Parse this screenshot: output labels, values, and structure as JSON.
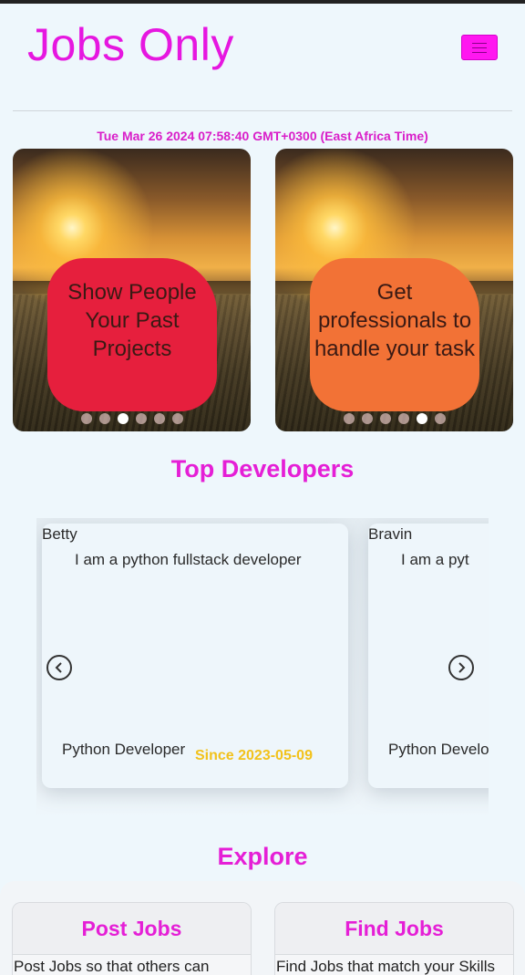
{
  "header": {
    "brand": "Jobs Only",
    "datetime": "Tue Mar 26 2024 07:58:40 GMT+0300 (East Africa Time)"
  },
  "hero_slides": [
    {
      "text": "Show People Your Past Projects",
      "color": "#e61f3d",
      "dots": 6,
      "active_dot": 3
    },
    {
      "text": "Get professionals to handle your task",
      "color": "#f27236",
      "dots": 6,
      "active_dot": 5
    }
  ],
  "top_developers": {
    "title": "Top Developers",
    "cards": [
      {
        "name": "Betty",
        "bio": "I am a python fullstack developer",
        "role": "Python Developer",
        "since": "Since 2023-05-09"
      },
      {
        "name": "Bravin",
        "bio": "I am a pyt",
        "role": "Python Develo",
        "since": ""
      }
    ]
  },
  "explore": {
    "title": "Explore",
    "cards": [
      {
        "title": "Post Jobs",
        "body": "Post Jobs so that others can"
      },
      {
        "title": "Find Jobs",
        "body": "Find Jobs that match your Skills"
      }
    ]
  },
  "colors": {
    "brand": "#e617e0",
    "accent_yellow": "#f2c21c",
    "menu_button": "#ff17f0"
  }
}
